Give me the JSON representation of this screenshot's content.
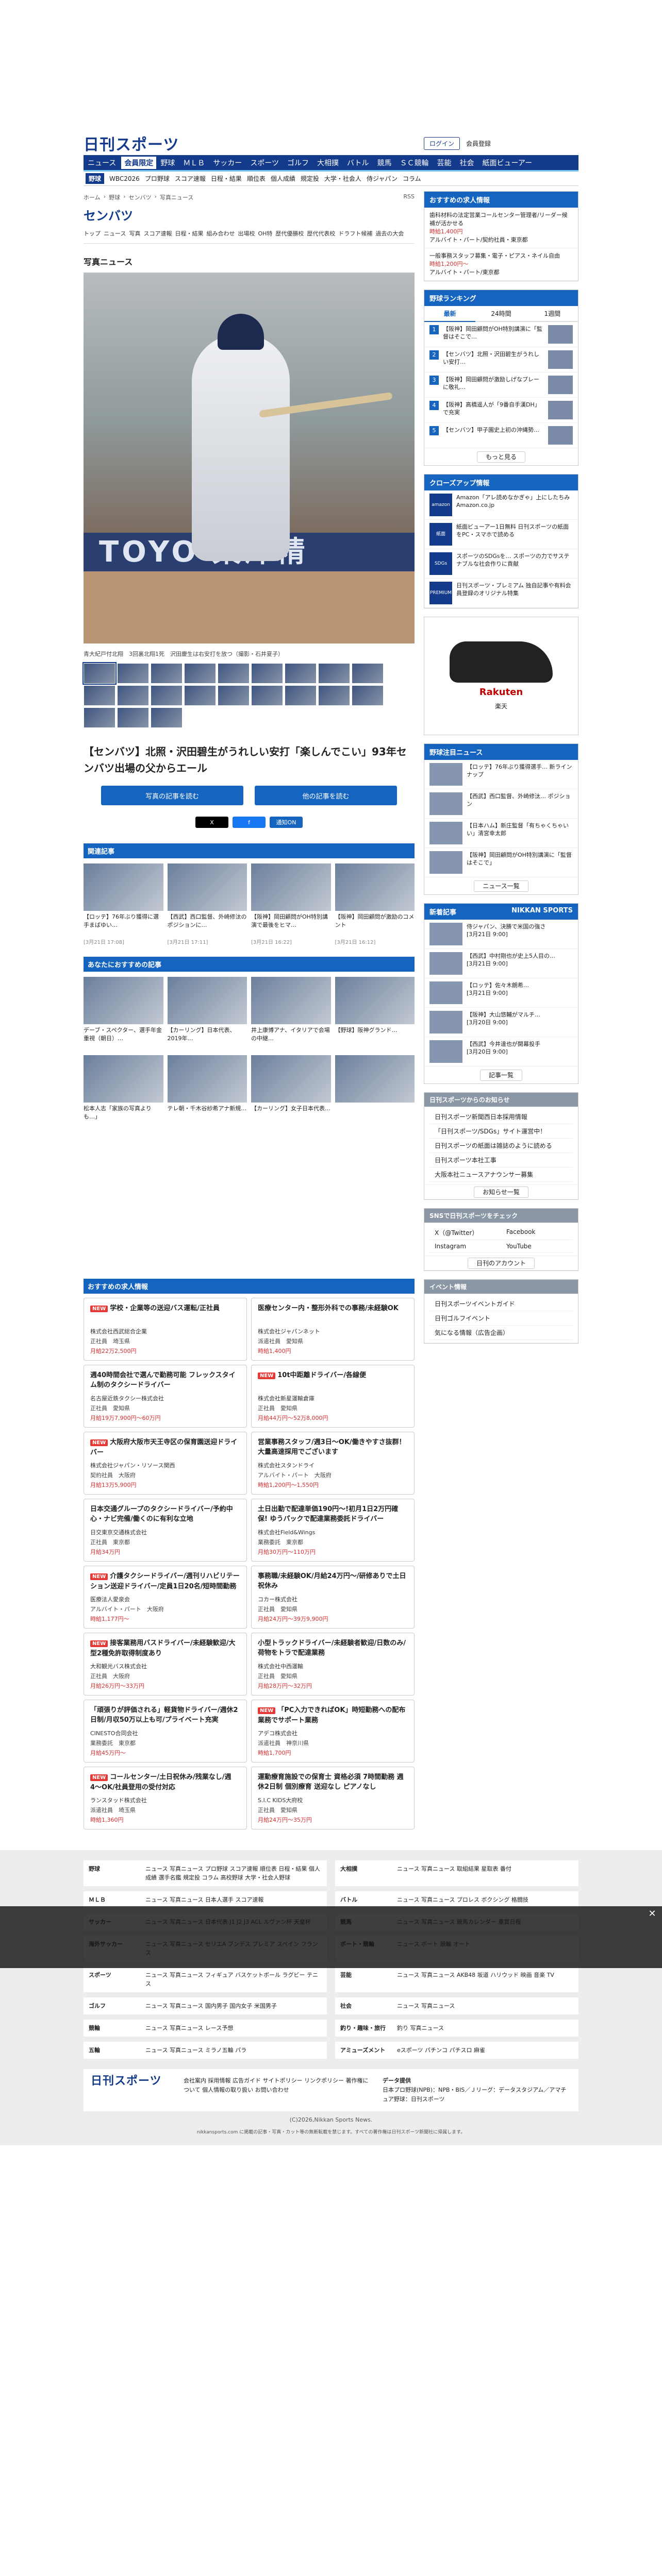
{
  "header": {
    "logo": "日刊スポーツ",
    "login": "ログイン",
    "member": "会員登録"
  },
  "nav1": [
    "ニュース",
    "会員限定",
    "野球",
    "ＭＬＢ",
    "サッカー",
    "スポーツ",
    "ゴルフ",
    "大相撲",
    "バトル",
    "競馬",
    "ＳＣ競輪",
    "芸能",
    "社会",
    "紙面ビューアー"
  ],
  "nav2": {
    "active": "野球",
    "items": [
      "WBC2026",
      "プロ野球",
      "スコア速報",
      "日程・結果",
      "順位表",
      "個人成績",
      "規定投",
      "大学・社会人",
      "侍ジャパン",
      "コラム"
    ]
  },
  "crumb": [
    "ホーム",
    "野球",
    "センバツ",
    "写真ニュース"
  ],
  "rss": "RSS",
  "page_title": "センバツ",
  "subnav": [
    "トップ",
    "ニュース",
    "写真",
    "スコア速報",
    "日程・結果",
    "組み合わせ",
    "出場校",
    "OH特",
    "歴代優勝校",
    "歴代代表校",
    "ドラフト候補",
    "過去の大会"
  ],
  "photo_heading": "写真ニュース",
  "photo_wall": "TOYO 東洋精",
  "caption": "青大紀戸付北翔　3回裏北翔1死　沢田慶生は右安打を放つ（撮影・石井夏子）",
  "article_title": "【センバツ】北照・沢田碧生がうれしい安打「楽しんでこい」93年センバツ出場の父からエール",
  "btn_article": "写真の記事を読む",
  "btn_other": "他の記事を読む",
  "share": {
    "x": "X",
    "fb": "f",
    "line": "通知ON"
  },
  "related_h": "関連記事",
  "related": [
    {
      "t": "【ロッテ】76年ぶり獲得に選手まばゆい…",
      "d": "[3月21日 17:08]"
    },
    {
      "t": "【西武】西口監督、外崎修汰のポジションに…",
      "d": "[3月21日 17:11]"
    },
    {
      "t": "【阪神】岡田顧問がOH特別講演で最後をヒマ…",
      "d": "[3月21日 16:22]"
    },
    {
      "t": "【阪神】岡田顧問が激励のコメント",
      "d": "[3月21日 16:12]"
    }
  ],
  "reco_h": "あなたにおすすめの記事",
  "reco": [
    {
      "t": "デーブ・スペクター、選手年金重視（朝日）…",
      "d": ""
    },
    {
      "t": "【カーリング】日本代表、2019年…",
      "d": ""
    },
    {
      "t": "井上康博アナ、イタリアで会場の中継…",
      "d": ""
    },
    {
      "t": "【野球】阪神グランド…",
      "d": ""
    },
    {
      "t": "松本人志「家族の写真よりも…」",
      "d": ""
    },
    {
      "t": "テレ朝・千木谷紗希アナ新規…",
      "d": ""
    },
    {
      "t": "【カーリング】女子日本代表…",
      "d": ""
    },
    {
      "t": "",
      "d": ""
    }
  ],
  "jobs_h": "おすすめの求人情報",
  "jobs": [
    {
      "new": "NEW",
      "t": "学校・企業等の送迎バス運転/正社員",
      "co": "株式会社西武総合企業",
      "m": "正社員　埼玉県",
      "pay": "月給22万2,500円"
    },
    {
      "new": "",
      "t": "医療センター内・整形外科での事務/未経験OK",
      "co": "株式会社ジャパンネット",
      "m": "派遣社員　愛知県",
      "pay": "時給1,400円"
    },
    {
      "new": "",
      "t": "週40時間会社で選んで勤務可能 フレックスタイム制のタクシードライバー",
      "co": "名古屋近鉄タクシー株式会社",
      "m": "正社員　愛知県",
      "pay": "月給19万7,900円〜60万円"
    },
    {
      "new": "NEW",
      "t": "10t中距離ドライバー/各線便",
      "co": "株式会社新星運輸倉庫",
      "m": "正社員　愛知県",
      "pay": "月給44万円〜52万8,000円"
    },
    {
      "new": "NEW",
      "t": "大阪府大阪市天王寺区の保育園送迎ドライバー",
      "co": "株式会社ジャパン・リソース関西",
      "m": "契約社員　大阪府",
      "pay": "月給13万5,900円"
    },
    {
      "new": "",
      "t": "営業事務スタッフ/週3日〜OK/働きやすさ抜群！大量高速採用でございます",
      "co": "株式会社スタンドライ",
      "m": "アルバイト・パート　大阪府",
      "pay": "時給1,200円〜1,550円"
    },
    {
      "new": "",
      "t": "日本交通グループのタクシードライバー/予約中心・ナビ完備/働くのに有利な立地",
      "co": "日交東京交通株式会社",
      "m": "正社員　東京都",
      "pay": "月給34万円"
    },
    {
      "new": "",
      "t": "土日出勤で配達単価190円〜!初月1日2万円確保! ゆうパックで配達業務委託ドライバー",
      "co": "株式会社Field&Wings",
      "m": "業務委託　東京都",
      "pay": "月給30万円〜110万円"
    },
    {
      "new": "NEW",
      "t": "介護タクシードライバー/週刊リハビリテーション送迎ドライバー/定員1日20名/短時間勤務",
      "co": "医療法人愛泉会",
      "m": "アルバイト・パート　大阪府",
      "pay": "時給1,177円〜"
    },
    {
      "new": "",
      "t": "事務職/未経験OK/月給24万円〜/研修ありで土日祝休み",
      "co": "コカー株式会社",
      "m": "正社員　愛知県",
      "pay": "月給24万円〜39万9,900円"
    },
    {
      "new": "NEW",
      "t": "接客業務用バスドライバー/未経験歓迎/大型2種免許取得制度あり",
      "co": "大和観光バス株式会社",
      "m": "正社員　大阪府",
      "pay": "月給26万円〜33万円"
    },
    {
      "new": "",
      "t": "小型トラックドライバー/未経験者歓迎/日数のみ/荷物をトラで配達業務",
      "co": "株式会社中西運輸",
      "m": "正社員　愛知県",
      "pay": "月給28万円〜32万円"
    },
    {
      "new": "",
      "t": "「頑張りが評価される」軽貨物ドライバー/週休2日制/月収50万以上も可/プライベート充実",
      "co": "CINESTO合同会社",
      "m": "業務委託　東京都",
      "pay": "月給45万円〜"
    },
    {
      "new": "NEW",
      "t": "「PC入力できればOK」時短勤務への配布業務でサポート業務",
      "co": "アデコ株式会社",
      "m": "派遣社員　神奈川県",
      "pay": "時給1,700円"
    },
    {
      "new": "NEW",
      "t": "コールセンター/土日祝休み/残業なし/週4〜OK/社員登用の受付対応",
      "co": "ランスタッド株式会社",
      "m": "派遣社員　埼玉県",
      "pay": "時給1,360円"
    },
    {
      "new": "",
      "t": "運動療育施設での保育士 資格必須 7時間勤務 週休2日制 個別療育 送迎なし ピアノなし",
      "co": "S.I.C KIDS大府校",
      "m": "正社員　愛知県",
      "pay": "月給24万円〜35万円"
    }
  ],
  "r_jobs_h": "おすすめの求人情報",
  "r_jobs": [
    {
      "t": "歯科材料の法定営業コールセンター管理者/リーダー候補が活かせる",
      "p": "時給1,400円",
      "m": "アルバイト・パート/契約社員・東京都"
    },
    {
      "t": "一般事務スタッフ募集・電子・ピアス・ネイル自由",
      "p": "時給1,200円〜",
      "m": "アルバイト・パート/東京都"
    }
  ],
  "rank_h": "野球ランキング",
  "rank_tabs": [
    "最新",
    "24時間",
    "1週間"
  ],
  "rank": [
    "【阪神】岡田顧問がOH特別講演に「監督はそこで…",
    "【センバツ】北照・沢田碧生がうれしい安打…",
    "【阪神】岡田顧問が激励しげなプレーに敬礼…",
    "【阪神】高橋遥人が「9番自手漢DH」で充実",
    "【センバツ】甲子園史上初の沖縄勢…"
  ],
  "rank_more": "もっと見る",
  "pr_h": "クローズアップ情報",
  "pr": [
    {
      "ic": "amazon",
      "t": "Amazon「アレ読めなかぎゃ」上にしたちみ",
      "s": "Amazon.co.jp"
    },
    {
      "ic": "紙面",
      "t": "紙面ビューアー1日無料 日刊スポーツの紙面をPC・スマホで読める",
      "s": ""
    },
    {
      "ic": "SDGs",
      "t": "スポーツのSDGsを… スポーツの力でサステナブルな社会作りに貢献",
      "s": ""
    },
    {
      "ic": "PREMIUM",
      "t": "日刊スポーツ・プレミアム 独自記事や有料会員登録のオリジナル特集",
      "s": ""
    }
  ],
  "ad_brand": "Rakuten",
  "ad_label": "楽天",
  "hot_h": "野球注目ニュース",
  "hot": [
    "【ロッテ】76年ぶり獲得選手… 新ラインナップ",
    "【西武】西口監督、外崎修汰… ポジション",
    "【日本ハム】新庄監督「有ちゃくちゃいい」清宮幸太郎",
    "【阪神】岡田顧問がOH特別講演に「監督はそこで」"
  ],
  "hot_more": "ニュース一覧",
  "nk_h": "新着記事",
  "nk_logo": "NIKKAN SPORTS",
  "nk": [
    {
      "t": "侍ジャパン、決勝で米国の強さ",
      "d": "[3月21日 9:00]"
    },
    {
      "t": "【西武】中村剛也が史上5人目の…",
      "d": "[3月21日 9:00]"
    },
    {
      "t": "【ロッテ】佐々木朗希…",
      "d": "[3月21日 9:00]"
    },
    {
      "t": "【阪神】大山悠輔がマルチ…",
      "d": "[3月20日 9:00]"
    },
    {
      "t": "【西武】今井達也が開幕投手",
      "d": "[3月20日 9:00]"
    }
  ],
  "nk_more": "記事一覧",
  "info_h": "日刊スポーツからのお知らせ",
  "info": [
    "日刊スポーツ新聞西日本採用情報",
    "「日刊スポーツ/SDGs」サイト運営中！",
    "日刊スポーツの紙面は雑誌のように読める",
    "日刊スポーツ本社工事",
    "大阪本社ニュースアナウンサー募集"
  ],
  "info_more": "お知らせ一覧",
  "sns_h": "SNSで日刊スポーツをチェック",
  "sns": [
    "X（@Twitter）",
    "Facebook",
    "Instagram",
    "YouTube"
  ],
  "sns_more": "日刊のアカウント",
  "event_h": "イベント情報",
  "events": [
    "日刊スポーツイベントガイド",
    "日刊ゴルフイベント",
    "気になる情報（広告企画）"
  ],
  "footer": [
    {
      "k": "野球",
      "v": "ニュース 写真ニュース プロ野球 スコア速報 順位表 日程・結果 個人成績 選手名鑑 規定投 コラム 高校野球 大学・社会人野球"
    },
    {
      "k": "大相撲",
      "v": "ニュース 写真ニュース 取組結果 星取表 番付"
    },
    {
      "k": "ＭＬＢ",
      "v": "ニュース 写真ニュース 日本人選手 スコア速報"
    },
    {
      "k": "バトル",
      "v": "ニュース 写真ニュース プロレス ボクシング 格闘技"
    },
    {
      "k": "サッカー",
      "v": "ニュース 写真ニュース 日本代表 J1 J2 J3 ACL ルヴァン杯 天皇杯"
    },
    {
      "k": "競馬",
      "v": "ニュース 写真ニュース 競馬カレンダー 重賞日程"
    },
    {
      "k": "海外サッカー",
      "v": "ニュース 写真ニュース セリエA ブンデス プレミア スペイン フランス"
    },
    {
      "k": "ボート・競輪",
      "v": "ニュース ボート 競輪 オート"
    },
    {
      "k": "スポーツ",
      "v": "ニュース 写真ニュース フィギュア バスケットボール ラグビー テニス"
    },
    {
      "k": "芸能",
      "v": "ニュース 写真ニュース AKB48 坂道 ハリウッド 映画 音楽 TV"
    },
    {
      "k": "ゴルフ",
      "v": "ニュース 写真ニュース 国内男子 国内女子 米国男子"
    },
    {
      "k": "社会",
      "v": "ニュース 写真ニュース"
    },
    {
      "k": "競輪",
      "v": "ニュース 写真ニュース レース予想"
    },
    {
      "k": "釣り・趣味・旅行",
      "v": "釣り 写真ニュース"
    },
    {
      "k": "五輪",
      "v": "ニュース 写真ニュース ミラノ五輪 パラ"
    },
    {
      "k": "アミューズメント",
      "v": "eスポーツ パチンコ パチスロ 麻雀"
    }
  ],
  "footer_bottom": {
    "logo": "日刊スポーツ",
    "links": "会社案内 採用情報 広告ガイド サイトポリシー リンクポリシー 著作権について 個人情報の取り扱い お問い合わせ",
    "data_h": "データ提供",
    "data": "日本プロ野球(NPB)：NPB・BIS／Ｊリーグ：データスタジアム／アマチュア野球：日刊スポーツ"
  },
  "copyright": "(C)2026,Nikkan Sports News.",
  "copyright2": "nikkansports.com に掲載の記事・写真・カット等の無断転載を禁じます。すべての著作権は日刊スポーツ新聞社に帰属します。"
}
